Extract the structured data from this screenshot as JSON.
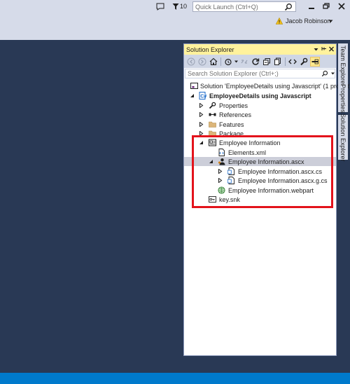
{
  "header": {
    "notification_count": "10",
    "quick_launch_placeholder": "Quick Launch (Ctrl+Q)",
    "user_name": "Jacob Robinson"
  },
  "solution_explorer": {
    "title": "Solution Explorer",
    "search_placeholder": "Search Solution Explorer (Ctrl+;)",
    "tree": {
      "solution": "Solution 'EmployeeDetails using Javascript' (1 project)",
      "project": "EmployeeDetails using Javascript",
      "properties": "Properties",
      "references": "References",
      "features": "Features",
      "package": "Package",
      "employee_information": "Employee Information",
      "elements_xml": "Elements.xml",
      "ascx": "Employee Information.ascx",
      "ascx_cs": "Employee Information.ascx.cs",
      "ascx_g_cs": "Employee Information.ascx.g.cs",
      "webpart": "Employee Information.webpart",
      "key_snk": "key.snk"
    }
  },
  "side_tabs": {
    "team_explorer": "Team Explorer",
    "properties": "Properties",
    "solution_explorer": "Solution Explorer"
  },
  "colors": {
    "editor_bg": "#293955",
    "chrome_bg": "#d6dbe9",
    "status_bar": "#007acc",
    "title_active": "#fff29d",
    "highlight": "#e3131b"
  }
}
